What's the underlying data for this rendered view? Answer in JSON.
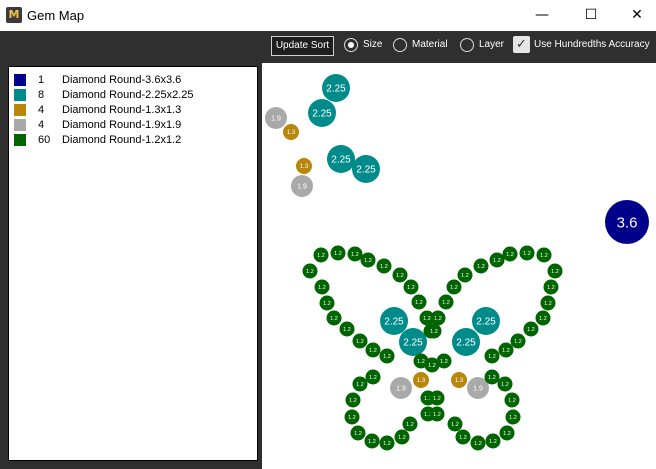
{
  "window": {
    "title": "Gem Map",
    "icon": "gem-map-logo-icon",
    "icon_glyph": "M",
    "minimize_glyph": "—",
    "maximize_glyph": "☐",
    "close_glyph": "✕"
  },
  "toolbar": {
    "update_sort_label": "Update Sort",
    "sort_options": [
      {
        "label": "Size",
        "selected": true
      },
      {
        "label": "Material",
        "selected": false
      },
      {
        "label": "Layer",
        "selected": false
      }
    ],
    "hundredths_label": "Use Hundredths Accuracy",
    "hundredths_checked": true,
    "check_glyph": "✓"
  },
  "legend": [
    {
      "count": "1",
      "name": "Diamond Round-3.6x3.6",
      "color": "#00008b"
    },
    {
      "count": "8",
      "name": "Diamond Round-2.25x2.25",
      "color": "#008b8b"
    },
    {
      "count": "4",
      "name": "Diamond Round-1.3x1.3",
      "color": "#b8860b"
    },
    {
      "count": "4",
      "name": "Diamond Round-1.9x1.9",
      "color": "#a9a9a9"
    },
    {
      "count": "60",
      "name": "Diamond Round-1.2x1.2",
      "color": "#006400"
    }
  ],
  "gem_labels": {
    "large": "3.6",
    "medium": "2.25",
    "gray": "1.9",
    "gold": "1.3",
    "small": "1.2"
  }
}
